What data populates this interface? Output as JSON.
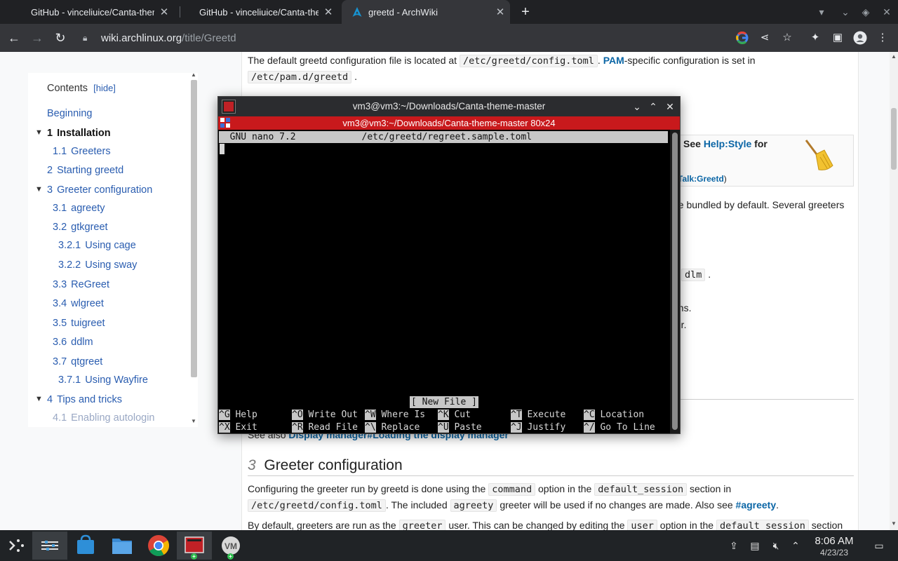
{
  "browser": {
    "tabs": [
      {
        "title": "GitHub - vinceliuice/Canta-theme-master",
        "active": false
      },
      {
        "title": "GitHub - vinceliuice/Canta-theme-master",
        "active": false
      },
      {
        "title": "greetd - ArchWiki",
        "active": true
      }
    ],
    "close_glyph": "✕",
    "new_tab_glyph": "+",
    "url_host": "wiki.archlinux.org",
    "url_path": "/title/Greetd"
  },
  "wiki": {
    "config_line": {
      "pre": "The default greetd configuration file is located at ",
      "code1": "/etc/greetd/config.toml",
      "mid": ". ",
      "pam": "PAM",
      "post": "-specific configuration is set in"
    },
    "config_line2": {
      "code": "/etc/pam.d/greetd",
      "post": "."
    },
    "notice": {
      "see": "See",
      "link": "Help:Style",
      "for": "for",
      "talk": "Talk:Greetd",
      "close_paren": ")"
    },
    "frag_bundled": "he bundled by default. Several greeters",
    "frag_dlm": "dlm",
    "frag_dlm_post": ".",
    "frag_ons": "ons.",
    "frag_ter": "ter.",
    "see_also_pre": "See also",
    "see_also_link": "Display manager#Loading the display manager",
    "section3": {
      "num": "3",
      "title": "Greeter configuration"
    },
    "para1": {
      "pre": "Configuring the greeter run by greetd is done using the ",
      "code1": "command",
      "mid1": " option in the ",
      "code2": "default_session",
      "post": " section in"
    },
    "para1b": {
      "code": "/etc/greetd/config.toml",
      "mid": ". The included ",
      "code2": "agreety",
      "post": " greeter will be used if no changes are made. Also see ",
      "link": "#agreety",
      "end": "."
    },
    "para2": {
      "pre": "By default, greeters are run as the ",
      "code1": "greeter",
      "mid1": " user. This can be changed by editing the ",
      "code2": "user",
      "mid2": " option in the ",
      "code3": "default_session",
      "post": " section"
    }
  },
  "toc": {
    "title": "Contents",
    "hide_label": "[hide]",
    "items": [
      {
        "num": "",
        "label": "Beginning"
      },
      {
        "num": "1",
        "label": "Installation"
      },
      {
        "num": "1.1",
        "label": "Greeters"
      },
      {
        "num": "2",
        "label": "Starting greetd"
      },
      {
        "num": "3",
        "label": "Greeter configuration"
      },
      {
        "num": "3.1",
        "label": "agreety"
      },
      {
        "num": "3.2",
        "label": "gtkgreet"
      },
      {
        "num": "3.2.1",
        "label": "Using cage"
      },
      {
        "num": "3.2.2",
        "label": "Using sway"
      },
      {
        "num": "3.3",
        "label": "ReGreet"
      },
      {
        "num": "3.4",
        "label": "wlgreet"
      },
      {
        "num": "3.5",
        "label": "tuigreet"
      },
      {
        "num": "3.6",
        "label": "ddlm"
      },
      {
        "num": "3.7",
        "label": "qtgreet"
      },
      {
        "num": "3.7.1",
        "label": "Using Wayfire"
      },
      {
        "num": "4",
        "label": "Tips and tricks"
      },
      {
        "num": "4.1",
        "label": "Enabling autologin"
      }
    ]
  },
  "terminal": {
    "title": "vm3@vm3:~/Downloads/Canta-theme-master",
    "subtitle": "vm3@vm3:~/Downloads/Canta-theme-master 80x24",
    "nano_header": "  GNU nano 7.2            /etc/greetd/regreet.sample.toml",
    "status": "[ New File ]",
    "shortcuts_row1": [
      {
        "key": "^G",
        "label": " Help"
      },
      {
        "key": "^O",
        "label": " Write Out"
      },
      {
        "key": "^W",
        "label": " Where Is"
      },
      {
        "key": "^K",
        "label": " Cut"
      },
      {
        "key": "^T",
        "label": " Execute"
      },
      {
        "key": "^C",
        "label": " Location"
      }
    ],
    "shortcuts_row2": [
      {
        "key": "^X",
        "label": " Exit"
      },
      {
        "key": "^R",
        "label": " Read File"
      },
      {
        "key": "^\\",
        "label": " Replace"
      },
      {
        "key": "^U",
        "label": " Paste"
      },
      {
        "key": "^J",
        "label": " Justify"
      },
      {
        "key": "^/",
        "label": " Go To Line"
      }
    ]
  },
  "taskbar": {
    "time": "8:06 AM",
    "date": "4/23/23",
    "badge": "+"
  },
  "colors": {
    "link": "#0b66a6",
    "terminal_accent": "#c8191c",
    "browser_dark": "#202124"
  }
}
